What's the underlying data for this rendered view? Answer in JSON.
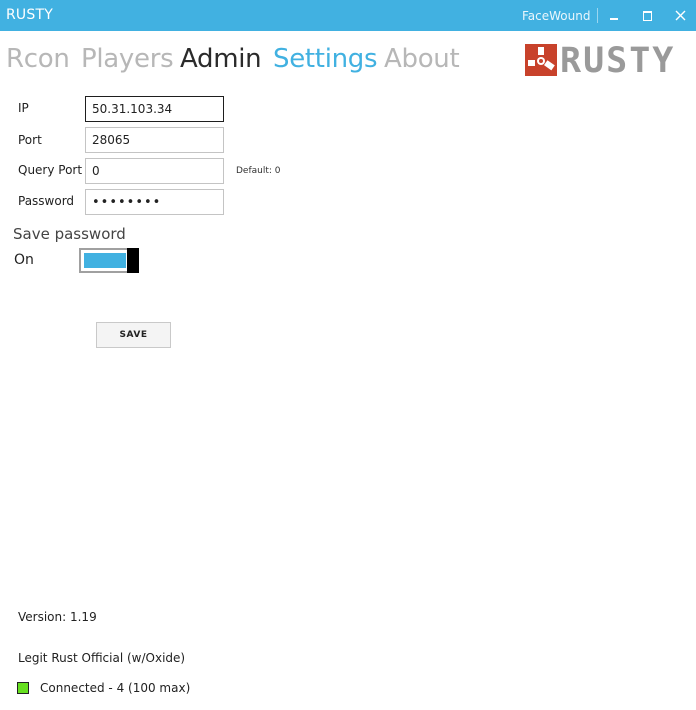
{
  "window": {
    "title": "RUSTY",
    "user": "FaceWound",
    "controls": {
      "minimize_icon": "minimize-icon",
      "maximize_icon": "maximize-icon",
      "close_icon": "close-icon"
    }
  },
  "nav": {
    "tabs": [
      {
        "label": "Rcon",
        "state": "inactive"
      },
      {
        "label": "Players",
        "state": "inactive"
      },
      {
        "label": "Admin",
        "state": "active"
      },
      {
        "label": "Settings",
        "state": "highlighted"
      },
      {
        "label": "About",
        "state": "inactive"
      }
    ]
  },
  "logo": {
    "text": "RUSTY",
    "icon": "rusty-logo-icon"
  },
  "form": {
    "ip": {
      "label": "IP",
      "value": "50.31.103.34"
    },
    "port": {
      "label": "Port",
      "value": "28065"
    },
    "query_port": {
      "label": "Query Port",
      "value": "0",
      "hint": "Default: 0"
    },
    "password": {
      "label": "Password",
      "value": "••••••••"
    },
    "save_password": {
      "label": "Save password",
      "state": "On",
      "enabled": true
    },
    "save_button": "SAVE"
  },
  "footer": {
    "version": "Version: 1.19",
    "server_name": "Legit Rust Official (w/Oxide)",
    "status": "Connected - 4 (100 max)"
  },
  "colors": {
    "accent": "#41b1e1",
    "titlebar": "#41b1e1",
    "status_connected": "#66e020",
    "logo_red": "#c8422b",
    "logo_gray": "#9a9a9a"
  }
}
